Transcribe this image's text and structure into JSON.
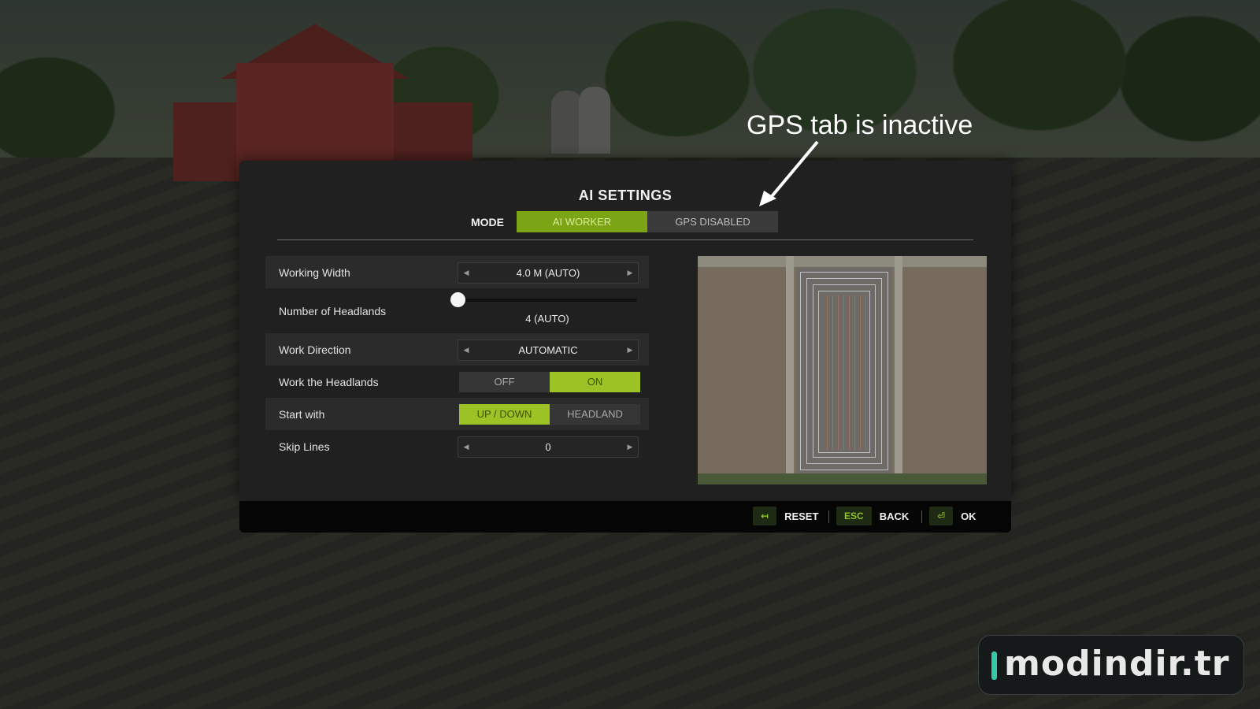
{
  "annotation": {
    "text": "GPS tab is inactive"
  },
  "dialog": {
    "title": "AI SETTINGS",
    "mode_label": "MODE",
    "tabs": [
      {
        "label": "AI WORKER",
        "active": true
      },
      {
        "label": "GPS DISABLED",
        "active": false
      }
    ]
  },
  "settings": {
    "working_width": {
      "label": "Working Width",
      "value": "4.0 M (AUTO)"
    },
    "headlands": {
      "label": "Number of Headlands",
      "value": "4 (AUTO)",
      "slider_fraction": 0
    },
    "work_direction": {
      "label": "Work Direction",
      "value": "AUTOMATIC"
    },
    "work_headlands": {
      "label": "Work the Headlands",
      "off": "OFF",
      "on": "ON",
      "selected": "ON"
    },
    "start_with": {
      "label": "Start with",
      "option_a": "UP / DOWN",
      "option_b": "HEADLAND",
      "selected": "UP / DOWN"
    },
    "skip_lines": {
      "label": "Skip Lines",
      "value": "0"
    }
  },
  "footer": {
    "reset": {
      "key_icon": "swap-arrows-icon",
      "key": "↤",
      "label": "RESET"
    },
    "back": {
      "key": "ESC",
      "label": "BACK"
    },
    "ok": {
      "key_icon": "enter-icon",
      "key": "⏎",
      "label": "OK"
    }
  },
  "watermark": {
    "text": "modindir.tr"
  },
  "colors": {
    "accent": "#7ba514",
    "toggle_active": "#9cc226",
    "panel": "#202020"
  }
}
